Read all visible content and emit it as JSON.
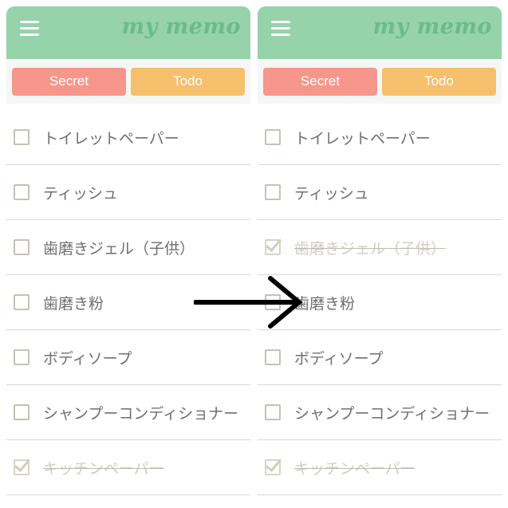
{
  "left_panel": {
    "logo": "my memo",
    "tabs": [
      {
        "label": "Secret"
      },
      {
        "label": "Todo"
      }
    ],
    "items": [
      {
        "label": "トイレットペーパー",
        "checked": false
      },
      {
        "label": "ティッシュ",
        "checked": false
      },
      {
        "label": "歯磨きジェル（子供）",
        "checked": false
      },
      {
        "label": "歯磨き粉",
        "checked": false
      },
      {
        "label": "ボディソープ",
        "checked": false
      },
      {
        "label": "シャンプーコンディショナー",
        "checked": false
      },
      {
        "label": "キッチンペーパー",
        "checked": true
      }
    ]
  },
  "right_panel": {
    "logo": "my memo",
    "tabs": [
      {
        "label": "Secret"
      },
      {
        "label": "Todo"
      }
    ],
    "items": [
      {
        "label": "トイレットペーパー",
        "checked": false
      },
      {
        "label": "ティッシュ",
        "checked": false
      },
      {
        "label": "歯磨きジェル（子供）",
        "checked": true
      },
      {
        "label": "歯磨き粉",
        "checked": false
      },
      {
        "label": "ボディソープ",
        "checked": false
      },
      {
        "label": "シャンプーコンディショナー",
        "checked": false
      },
      {
        "label": "キッチンペーパー",
        "checked": true
      }
    ]
  },
  "colors": {
    "header": "#96d2aa",
    "secret_tab": "#f7968a",
    "todo_tab": "#f5bf6c"
  },
  "arrow_icon": "right-arrow-icon"
}
